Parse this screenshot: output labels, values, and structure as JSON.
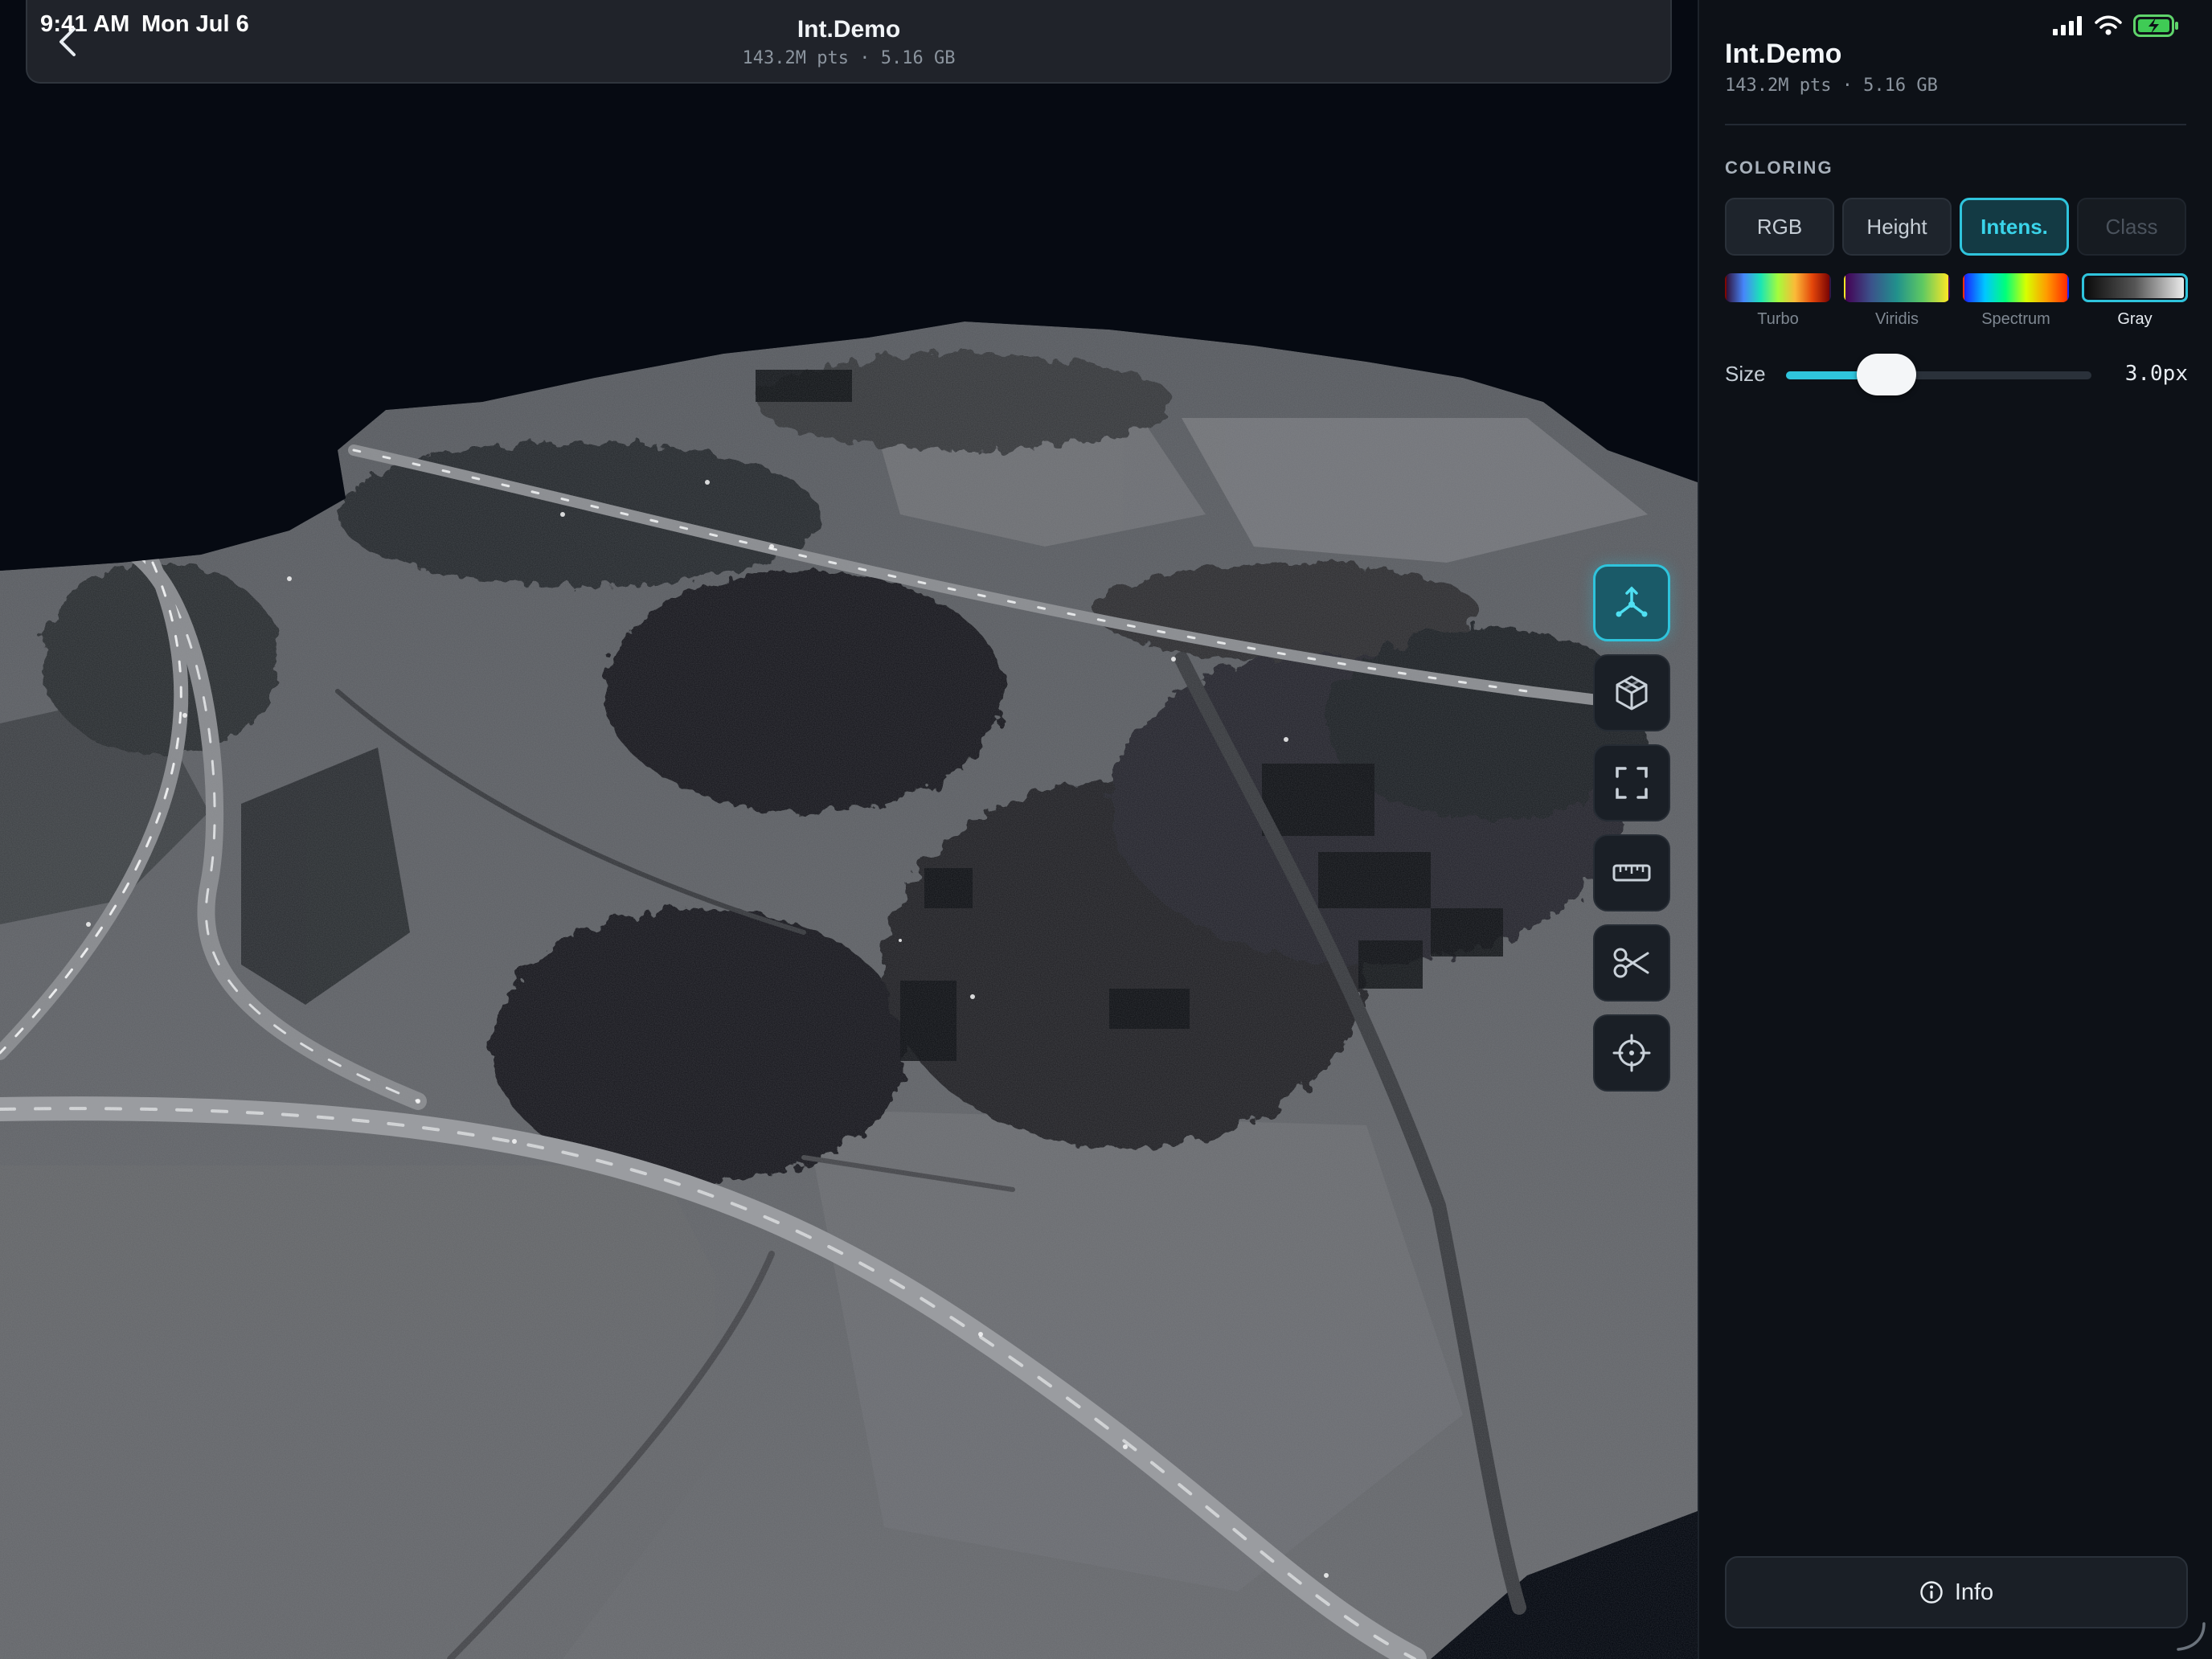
{
  "status_bar": {
    "time": "9:41 AM",
    "date": "Mon Jul 6"
  },
  "header": {
    "title": "Int.Demo",
    "subtitle": "143.2M pts · 5.16 GB"
  },
  "toolbar": {
    "tools": [
      {
        "name": "orbit-tool",
        "icon": "orbit-axes-icon",
        "active": true
      },
      {
        "name": "view-cube-tool",
        "icon": "cube-icon",
        "active": false
      },
      {
        "name": "fit-view-tool",
        "icon": "frame-corners-icon",
        "active": false
      },
      {
        "name": "measure-tool",
        "icon": "ruler-icon",
        "active": false
      },
      {
        "name": "clip-tool",
        "icon": "scissors-icon",
        "active": false
      },
      {
        "name": "locate-tool",
        "icon": "crosshair-icon",
        "active": false
      }
    ]
  },
  "panel": {
    "title": "Int.Demo",
    "subtitle": "143.2M pts · 5.16 GB",
    "coloring_label": "COLORING",
    "modes": [
      {
        "label": "RGB",
        "state": "normal"
      },
      {
        "label": "Height",
        "state": "normal"
      },
      {
        "label": "Intens.",
        "state": "active"
      },
      {
        "label": "Class",
        "state": "disabled"
      }
    ],
    "ramps": [
      {
        "label": "Turbo",
        "active": false
      },
      {
        "label": "Viridis",
        "active": false
      },
      {
        "label": "Spectrum",
        "active": false
      },
      {
        "label": "Gray",
        "active": true
      }
    ],
    "size": {
      "label": "Size",
      "value_text": "3.0px",
      "level": 0.33
    },
    "info_label": "Info"
  },
  "colors": {
    "accent": "#2fc4dc",
    "panel_bg": "#0d1117",
    "viewport_bg": "#060a12"
  }
}
